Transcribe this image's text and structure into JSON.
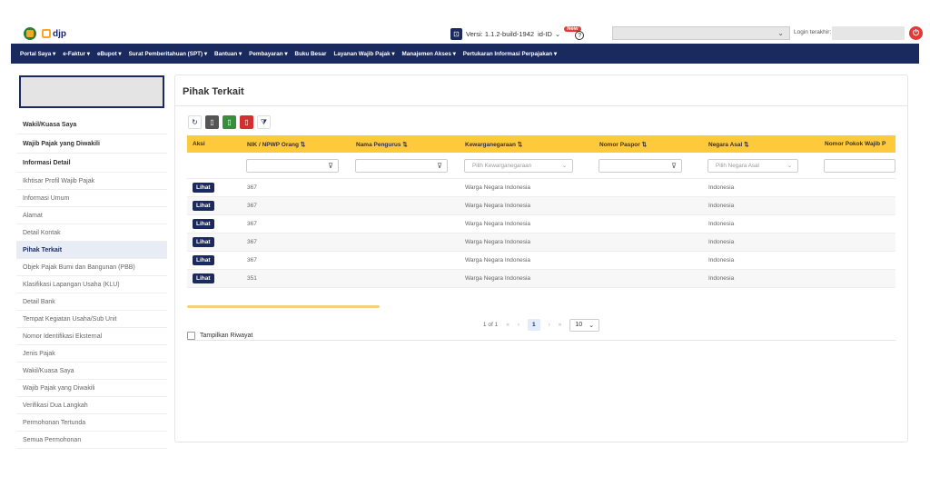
{
  "header": {
    "logo_text": "djp",
    "version_label": "Versi: 1.1.2-build-1942",
    "language": "id-ID",
    "new_badge": "New",
    "help_icon": "question-icon",
    "login_label": "Login terakhir:"
  },
  "nav": {
    "items": [
      "Portal Saya ▾",
      "e-Faktur ▾",
      "eBupot ▾",
      "Surat Pemberitahuan (SPT) ▾",
      "Bantuan ▾",
      "Pembayaran ▾",
      "Buku Besar",
      "Layanan Wajib Pajak ▾",
      "Manajemen Akses ▾",
      "Pertukaran Informasi Perpajakan ▾"
    ]
  },
  "sidebar": {
    "items": [
      {
        "label": "Wakil/Kuasa Saya",
        "style": "bold"
      },
      {
        "label": "Wajib Pajak yang Diwakili",
        "style": "bold"
      },
      {
        "label": "Informasi Detail",
        "style": "bold"
      },
      {
        "label": "Ikhtisar Profil Wajib Pajak",
        "style": "normal"
      },
      {
        "label": "Informasi Umum",
        "style": "normal"
      },
      {
        "label": "Alamat",
        "style": "normal"
      },
      {
        "label": "Detail Kontak",
        "style": "normal"
      },
      {
        "label": "Pihak Terkait",
        "style": "active"
      },
      {
        "label": "Objek Pajak Bumi dan Bangunan (PBB)",
        "style": "normal"
      },
      {
        "label": "Klasifikasi Lapangan Usaha (KLU)",
        "style": "normal"
      },
      {
        "label": "Detail Bank",
        "style": "normal"
      },
      {
        "label": "Tempat Kegiatan Usaha/Sub Unit",
        "style": "normal"
      },
      {
        "label": "Nomor Identifikasi Eksternal",
        "style": "normal"
      },
      {
        "label": "Jenis Pajak",
        "style": "normal"
      },
      {
        "label": "Wakil/Kuasa Saya",
        "style": "normal"
      },
      {
        "label": "Wajib Pajak yang Diwakili",
        "style": "normal"
      },
      {
        "label": "Verifikasi Dua Langkah",
        "style": "normal"
      },
      {
        "label": "Permohonan Tertunda",
        "style": "normal"
      },
      {
        "label": "Semua Permohonan",
        "style": "normal"
      }
    ]
  },
  "main": {
    "title": "Pihak Terkait",
    "toolbar": [
      "refresh-icon",
      "file-icon",
      "excel-icon",
      "pdf-icon",
      "filter-clear-icon"
    ],
    "columns": [
      "Aksi",
      "NIK / NPWP Orang ⇅",
      "Nama Pengurus ⇅",
      "Kewarganegaraan ⇅",
      "Nomor Paspor ⇅",
      "Negara Asal ⇅",
      "Nomor Pokok Wajib P"
    ],
    "filters": {
      "kewarganegaraan_placeholder": "Pilih Kewarganegaraan",
      "negara_placeholder": "Pilih Negara Asal"
    },
    "action_label": "Lihat",
    "rows": [
      {
        "nik": "367",
        "nama": "",
        "kewarganegaraan": "Warga Negara Indonesia",
        "paspor": "",
        "negara": "Indonesia",
        "npwp": ""
      },
      {
        "nik": "367",
        "nama": "",
        "kewarganegaraan": "Warga Negara Indonesia",
        "paspor": "",
        "negara": "Indonesia",
        "npwp": ""
      },
      {
        "nik": "367",
        "nama": "",
        "kewarganegaraan": "Warga Negara Indonesia",
        "paspor": "",
        "negara": "Indonesia",
        "npwp": ""
      },
      {
        "nik": "367",
        "nama": "",
        "kewarganegaraan": "Warga Negara Indonesia",
        "paspor": "",
        "negara": "Indonesia",
        "npwp": ""
      },
      {
        "nik": "367",
        "nama": "",
        "kewarganegaraan": "Warga Negara Indonesia",
        "paspor": "",
        "negara": "Indonesia",
        "npwp": ""
      },
      {
        "nik": "351",
        "nama": "",
        "kewarganegaraan": "Warga Negara Indonesia",
        "paspor": "",
        "negara": "Indonesia",
        "npwp": ""
      }
    ],
    "pagination": {
      "summary": "1 of 1",
      "first": "«",
      "prev": "‹",
      "current_page": "1",
      "next": "›",
      "last": "»",
      "page_size": "10"
    },
    "history_label": "Tampilkan Riwayat"
  }
}
